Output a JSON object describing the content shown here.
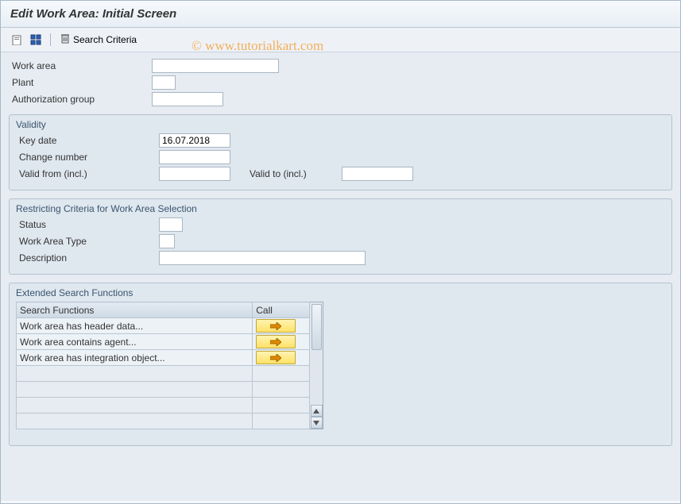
{
  "title": "Edit Work Area: Initial Screen",
  "watermark": "© www.tutorialkart.com",
  "toolbar": {
    "search_criteria_label": "Search Criteria"
  },
  "top_fields": {
    "work_area_label": "Work area",
    "work_area_value": "",
    "plant_label": "Plant",
    "plant_value": "",
    "auth_group_label": "Authorization group",
    "auth_group_value": ""
  },
  "validity": {
    "group_title": "Validity",
    "key_date_label": "Key date",
    "key_date_value": "16.07.2018",
    "change_number_label": "Change number",
    "change_number_value": "",
    "valid_from_label": "Valid from (incl.)",
    "valid_from_value": "",
    "valid_to_label": "Valid to (incl.)",
    "valid_to_value": ""
  },
  "restrict": {
    "group_title": "Restricting Criteria for Work Area Selection",
    "status_label": "Status",
    "status_value": "",
    "type_label": "Work Area Type",
    "type_value": "",
    "desc_label": "Description",
    "desc_value": ""
  },
  "extended": {
    "group_title": "Extended Search Functions",
    "col_functions": "Search Functions",
    "col_call": "Call",
    "rows": [
      {
        "label": "Work area has header data..."
      },
      {
        "label": "Work area contains agent..."
      },
      {
        "label": "Work area has integration object..."
      }
    ]
  },
  "colors": {
    "accent_yellow": "#ffe168"
  }
}
